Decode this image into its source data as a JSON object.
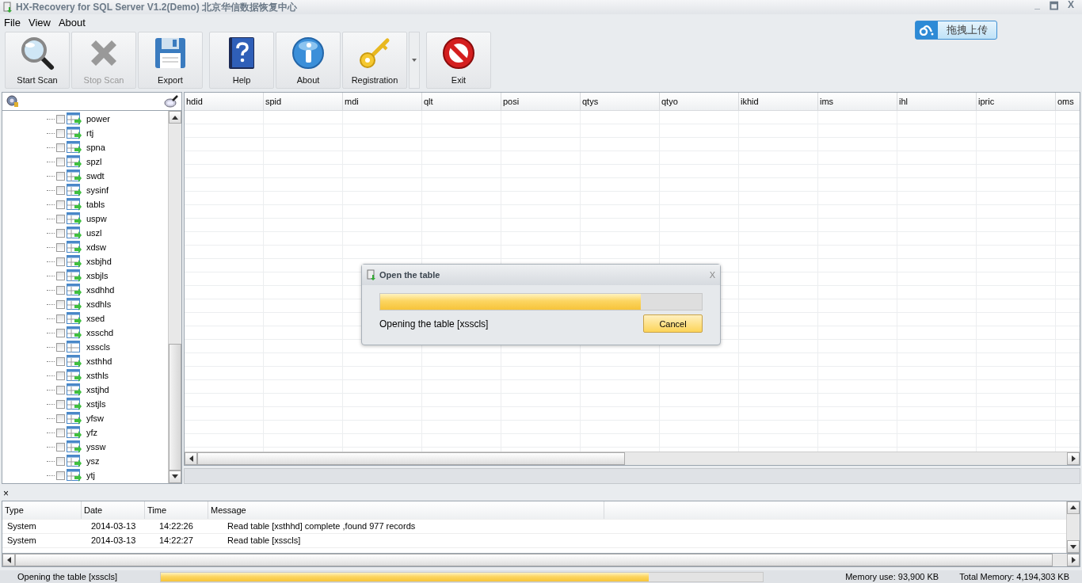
{
  "window": {
    "title": "HX-Recovery for SQL Server V1.2(Demo) 北京华信数据恢复中心",
    "controls": [
      "_",
      "🗖",
      "X"
    ]
  },
  "menu": [
    "File",
    "View",
    "About"
  ],
  "upload_button": {
    "label": "拖拽上传"
  },
  "toolbar": [
    {
      "label": "Start Scan",
      "disabled": false
    },
    {
      "label": "Stop Scan",
      "disabled": true
    },
    {
      "label": "Export",
      "disabled": false
    },
    {
      "label": "Help",
      "disabled": false
    },
    {
      "label": "About",
      "disabled": false
    },
    {
      "label": "Registration",
      "disabled": false
    },
    {
      "label": "Exit",
      "disabled": false
    }
  ],
  "tree": {
    "items": [
      {
        "name": "power",
        "kind": "linked",
        "checked": false
      },
      {
        "name": "rtj",
        "kind": "linked",
        "checked": false
      },
      {
        "name": "spna",
        "kind": "linked",
        "checked": false
      },
      {
        "name": "spzl",
        "kind": "linked",
        "checked": false
      },
      {
        "name": "swdt",
        "kind": "linked",
        "checked": false
      },
      {
        "name": "sysinf",
        "kind": "linked",
        "checked": false
      },
      {
        "name": "tabls",
        "kind": "linked",
        "checked": false
      },
      {
        "name": "uspw",
        "kind": "linked",
        "checked": false
      },
      {
        "name": "uszl",
        "kind": "linked",
        "checked": false
      },
      {
        "name": "xdsw",
        "kind": "linked",
        "checked": false
      },
      {
        "name": "xsbjhd",
        "kind": "linked",
        "checked": false
      },
      {
        "name": "xsbjls",
        "kind": "linked",
        "checked": false
      },
      {
        "name": "xsdhhd",
        "kind": "linked",
        "checked": false
      },
      {
        "name": "xsdhls",
        "kind": "linked",
        "checked": false
      },
      {
        "name": "xsed",
        "kind": "linked",
        "checked": false
      },
      {
        "name": "xsschd",
        "kind": "linked",
        "checked": false
      },
      {
        "name": "xsscls",
        "kind": "table",
        "checked": false
      },
      {
        "name": "xsthhd",
        "kind": "linked",
        "checked": false
      },
      {
        "name": "xsthls",
        "kind": "linked",
        "checked": false
      },
      {
        "name": "xstjhd",
        "kind": "linked",
        "checked": false
      },
      {
        "name": "xstjls",
        "kind": "linked",
        "checked": false
      },
      {
        "name": "yfsw",
        "kind": "linked",
        "checked": false
      },
      {
        "name": "yfz",
        "kind": "linked",
        "checked": false
      },
      {
        "name": "yssw",
        "kind": "linked",
        "checked": false
      },
      {
        "name": "ysz",
        "kind": "linked",
        "checked": false
      },
      {
        "name": "ytj",
        "kind": "linked",
        "checked": false
      }
    ]
  },
  "grid": {
    "columns": [
      "hdid",
      "spid",
      "mdi",
      "qlt",
      "posi",
      "qtys",
      "qtyo",
      "ikhid",
      "ims",
      "ihl",
      "ipric",
      "oms"
    ]
  },
  "dialog": {
    "title": "Open the table",
    "close": "X",
    "level": 0.81,
    "message": "Opening the table [xsscls]",
    "button": "Cancel"
  },
  "log": {
    "close": "×",
    "columns": [
      "Type",
      "Date",
      "Time",
      "Message"
    ],
    "rows": [
      [
        "System",
        "2014-03-13",
        "14:22:26",
        "Read table [xsthhd] complete ,found 977 records"
      ],
      [
        "System",
        "2014-03-13",
        "14:22:27",
        "Read table [xsscls]"
      ]
    ]
  },
  "status_bar": {
    "text": "Opening the table [xsscls]",
    "level": 0.81,
    "memory_use": "Memory use: 93,900 KB",
    "total_memory": "Total Memory: 4,194,303 KB"
  }
}
